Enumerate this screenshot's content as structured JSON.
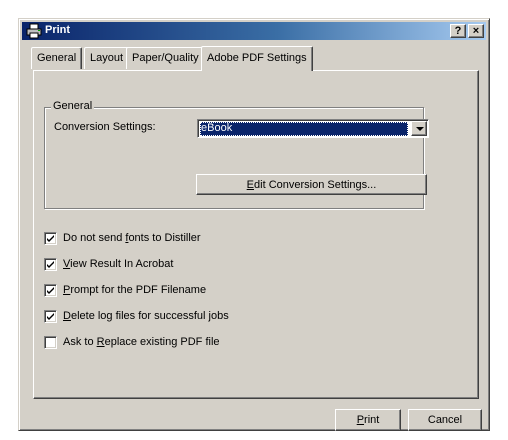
{
  "window": {
    "title": "Print",
    "help_button": "?",
    "close_button": "×"
  },
  "tabs": [
    {
      "label": "General",
      "active": false
    },
    {
      "label": "Layout",
      "active": false
    },
    {
      "label": "Paper/Quality",
      "active": false
    },
    {
      "label": "Adobe PDF Settings",
      "active": true
    }
  ],
  "general_group": {
    "label": "General",
    "conversion_label": "Conversion Settings:",
    "conversion_value": "eBook",
    "edit_button": {
      "accel": "E",
      "rest": "dit Conversion Settings..."
    }
  },
  "options": [
    {
      "pre": "Do not send ",
      "accel": "f",
      "post": "onts to Distiller",
      "checked": true
    },
    {
      "pre": "",
      "accel": "V",
      "post": "iew Result In Acrobat",
      "checked": true
    },
    {
      "pre": "",
      "accel": "P",
      "post": "rompt for the PDF Filename",
      "checked": true
    },
    {
      "pre": "",
      "accel": "D",
      "post": "elete log files for successful jobs",
      "checked": true
    },
    {
      "pre": "Ask to ",
      "accel": "R",
      "post": "eplace existing PDF file",
      "checked": false
    }
  ],
  "footer": {
    "print": {
      "accel": "P",
      "rest": "rint"
    },
    "cancel_label": "Cancel"
  }
}
